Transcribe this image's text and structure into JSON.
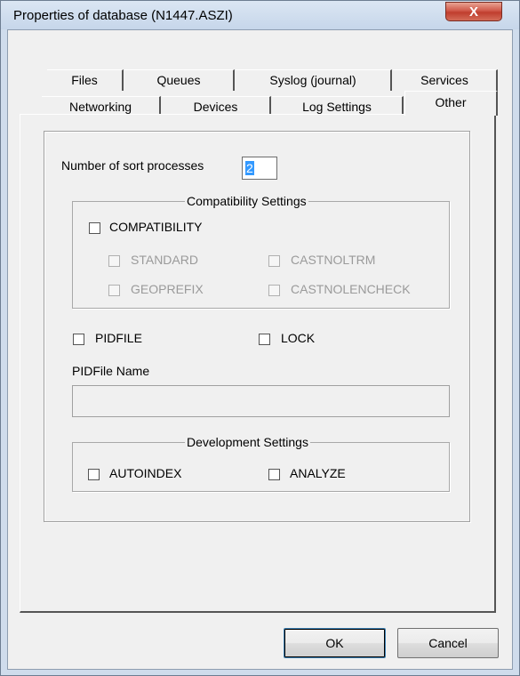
{
  "window": {
    "title": "Properties of database (N1447.ASZI)",
    "close_label": "X"
  },
  "tabs": {
    "row_back": [
      "Files",
      "Queues",
      "Syslog (journal)",
      "Services"
    ],
    "row_front": [
      "Networking",
      "Devices",
      "Log Settings",
      "Other"
    ],
    "active": "Other"
  },
  "other": {
    "sort_label": "Number of sort processes",
    "sort_value": "2",
    "compat_group_title": "Compatibility Settings",
    "compat_label": "COMPATIBILITY",
    "standard_label": "STANDARD",
    "castnoltrm_label": "CASTNOLTRM",
    "geoprefix_label": "GEOPREFIX",
    "castnolencheck_label": "CASTNOLENCHECK",
    "pidfile_label": "PIDFILE",
    "lock_label": "LOCK",
    "pidfile_name_label": "PIDFile Name",
    "pidfile_name_value": "",
    "dev_group_title": "Development Settings",
    "autoindex_label": "AUTOINDEX",
    "analyze_label": "ANALYZE"
  },
  "buttons": {
    "ok": "OK",
    "cancel": "Cancel"
  },
  "colors": {
    "selection": "#3399ff",
    "close_button": "#c94a3a"
  }
}
